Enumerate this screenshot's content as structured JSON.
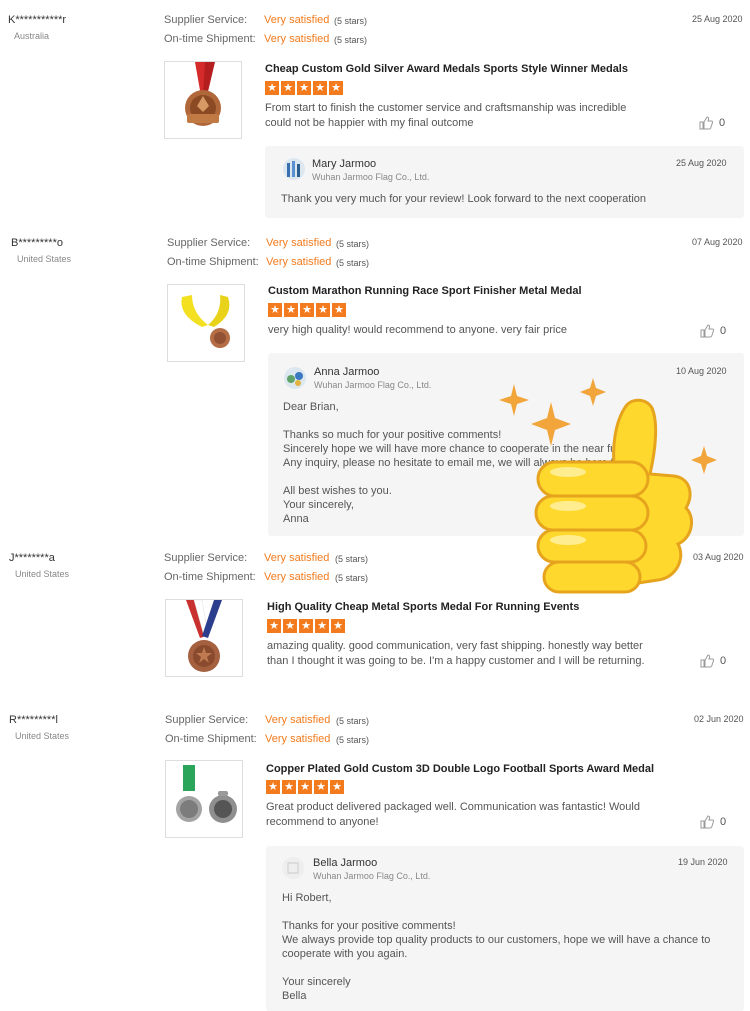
{
  "labels": {
    "service": "Supplier Service:",
    "shipment": "On-time Shipment:"
  },
  "reviews": [
    {
      "buyer": "K***********r",
      "country": "Australia",
      "date": "25 Aug 2020",
      "service_value": "Very satisfied",
      "service_stars": "(5 stars)",
      "shipment_value": "Very satisfied",
      "shipment_stars": "(5 stars)",
      "product_title": "Cheap Custom Gold Silver Award Medals Sports Style Winner Medals",
      "text": "From start to finish the customer service and craftsmanship was incredible could not be happier with my final outcome",
      "likes": "0",
      "reply": {
        "name": "Mary Jarmoo",
        "company": "Wuhan Jarmoo Flag Co., Ltd.",
        "date": "25 Aug 2020",
        "text": "Thank you very much for your review! Look forward to the next cooperation"
      }
    },
    {
      "buyer": "B*********o",
      "country": "United States",
      "date": "07 Aug 2020",
      "service_value": "Very satisfied",
      "service_stars": "(5 stars)",
      "shipment_value": "Very satisfied",
      "shipment_stars": "(5 stars)",
      "product_title": "Custom Marathon Running Race Sport Finisher Metal Medal",
      "text": "very high quality! would recommend to anyone. very fair price",
      "likes": "0",
      "reply": {
        "name": "Anna Jarmoo",
        "company": "Wuhan Jarmoo Flag Co., Ltd.",
        "date": "10 Aug 2020",
        "text": "Dear Brian,\n\nThanks so much for your positive comments!\nSincerely hope we will have more chance to cooperate in the near future\nAny inquiry, please no hesitate to email me, we will always be here for you !\n\nAll best wishes to you.\nYour sincerely,\nAnna"
      }
    },
    {
      "buyer": "J********a",
      "country": "United States",
      "date": "03 Aug 2020",
      "service_value": "Very satisfied",
      "service_stars": "(5 stars)",
      "shipment_value": "Very satisfied",
      "shipment_stars": "(5 stars)",
      "product_title": "High Quality Cheap Metal Sports Medal For Running Events",
      "text": "amazing quality. good communication, very fast shipping.  honestly way better than I thought it was going to be. I'm a happy customer and I will be returning.",
      "likes": "0"
    },
    {
      "buyer": "R*********l",
      "country": "United States",
      "date": "02 Jun 2020",
      "service_value": "Very satisfied",
      "service_stars": "(5 stars)",
      "shipment_value": "Very satisfied",
      "shipment_stars": "(5 stars)",
      "product_title": "Copper Plated Gold Custom 3D Double Logo Football Sports Award Medal",
      "text": "Great product delivered packaged well.  Communication was fantastic!  Would recommend to anyone!",
      "likes": "0",
      "reply": {
        "name": "Bella Jarmoo",
        "company": "Wuhan Jarmoo Flag Co., Ltd.",
        "date": "19 Jun 2020",
        "text": "Hi Robert,\n\nThanks for your positive comments!\nWe always provide top quality products to our customers, hope we will have a chance to cooperate with you again.\n\nYour sincerely\nBella"
      }
    }
  ],
  "colors": {
    "accent": "#f37b1d",
    "reply_bg": "#f5f5f5"
  },
  "icons": {
    "like": "thumb-up-icon",
    "star": "star-icon",
    "overlay": "thumbs-up-sticker"
  }
}
